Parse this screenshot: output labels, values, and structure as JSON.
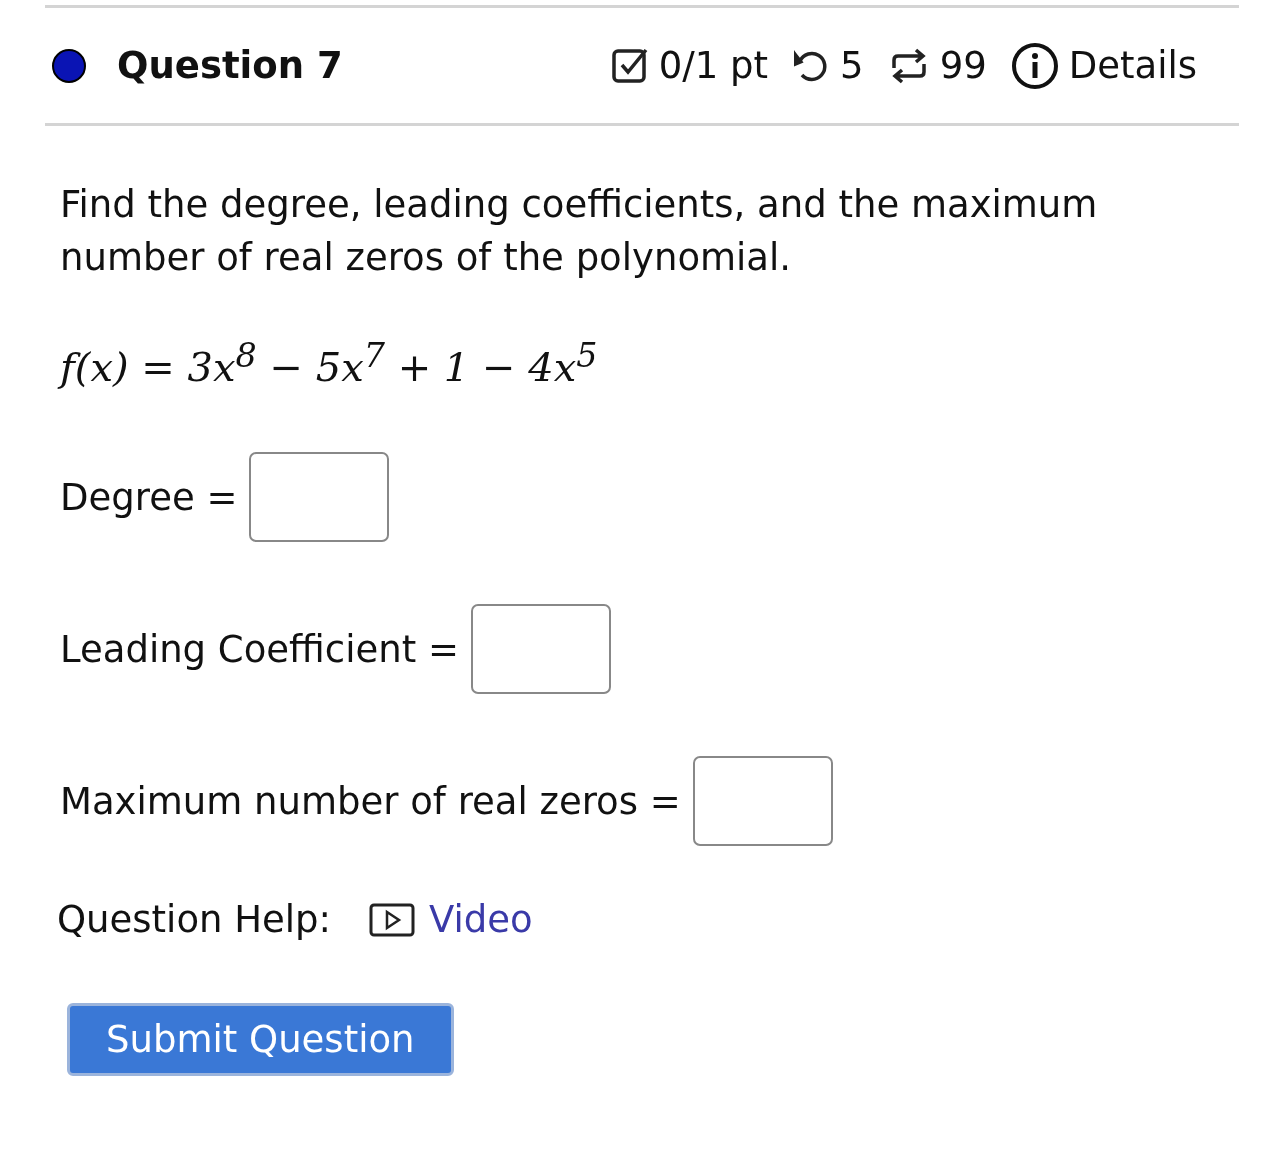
{
  "header": {
    "title": "Question 7",
    "score": "0/1 pt",
    "retries": "5",
    "attempts": "99",
    "details": "Details"
  },
  "prompt": "Find the degree, leading coefficients, and the maximum number of real zeros of the polynomial.",
  "formula": "f(x) = 3x$^{8}$ − 5x$^{7}$ + 1 − 4x$^{5}$",
  "answers": [
    {
      "label": "Degree ="
    },
    {
      "label": "Leading Coefficient ="
    },
    {
      "label": "Maximum number of real zeros ="
    }
  ],
  "help": {
    "label": "Question Help:",
    "link": "Video"
  },
  "submit": "Submit Question"
}
